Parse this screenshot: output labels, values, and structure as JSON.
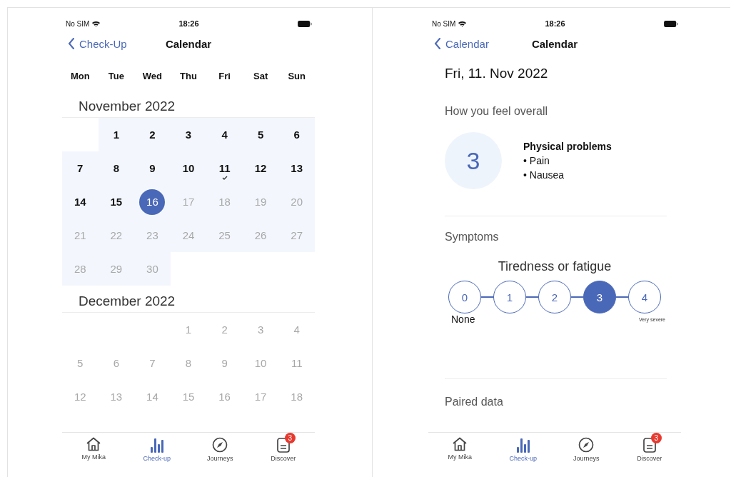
{
  "screens": [
    {
      "kind": "calendar",
      "status_bar": {
        "carrier": "No SIM",
        "time": "18:26"
      },
      "nav": {
        "back": "Check-Up",
        "title": "Calendar"
      },
      "weekdays": [
        "Mon",
        "Tue",
        "Wed",
        "Thu",
        "Fri",
        "Sat",
        "Sun"
      ],
      "months": [
        {
          "title": "November 2022",
          "weeks": [
            {
              "kind": "offset",
              "days": [
                {
                  "label": "1",
                  "past": true,
                  "in_month_range": true,
                  "selected": false,
                  "checked": false
                },
                {
                  "label": "2",
                  "past": true,
                  "in_month_range": true,
                  "selected": false,
                  "checked": false
                },
                {
                  "label": "3",
                  "past": true,
                  "in_month_range": true,
                  "selected": false,
                  "checked": false
                },
                {
                  "label": "4",
                  "past": true,
                  "in_month_range": true,
                  "selected": false,
                  "checked": false
                },
                {
                  "label": "5",
                  "past": true,
                  "in_month_range": true,
                  "selected": false,
                  "checked": false
                },
                {
                  "label": "6",
                  "past": true,
                  "in_month_range": true,
                  "selected": false,
                  "checked": false
                }
              ]
            },
            {
              "kind": "plain",
              "days": [
                {
                  "label": "7",
                  "past": true,
                  "in_month_range": true,
                  "selected": false,
                  "checked": false
                },
                {
                  "label": "8",
                  "past": true,
                  "in_month_range": true,
                  "selected": false,
                  "checked": false
                },
                {
                  "label": "9",
                  "past": true,
                  "in_month_range": true,
                  "selected": false,
                  "checked": false
                },
                {
                  "label": "10",
                  "past": true,
                  "in_month_range": true,
                  "selected": false,
                  "checked": false
                },
                {
                  "label": "11",
                  "past": true,
                  "in_month_range": true,
                  "selected": false,
                  "checked": true
                },
                {
                  "label": "12",
                  "past": true,
                  "in_month_range": true,
                  "selected": false,
                  "checked": false
                },
                {
                  "label": "13",
                  "past": true,
                  "in_month_range": true,
                  "selected": false,
                  "checked": false
                }
              ]
            },
            {
              "kind": "plain",
              "days": [
                {
                  "label": "14",
                  "past": true,
                  "in_month_range": true,
                  "selected": false,
                  "checked": false
                },
                {
                  "label": "15",
                  "past": true,
                  "in_month_range": true,
                  "selected": false,
                  "checked": false
                },
                {
                  "label": "16",
                  "past": true,
                  "in_month_range": true,
                  "selected": true,
                  "checked": false
                },
                {
                  "label": "17",
                  "past": false,
                  "in_month_range": true,
                  "selected": false,
                  "checked": false
                },
                {
                  "label": "18",
                  "past": false,
                  "in_month_range": true,
                  "selected": false,
                  "checked": false
                },
                {
                  "label": "19",
                  "past": false,
                  "in_month_range": true,
                  "selected": false,
                  "checked": false
                },
                {
                  "label": "20",
                  "past": false,
                  "in_month_range": true,
                  "selected": false,
                  "checked": false
                }
              ]
            },
            {
              "kind": "plain",
              "days": [
                {
                  "label": "21",
                  "past": false,
                  "in_month_range": true,
                  "selected": false,
                  "checked": false
                },
                {
                  "label": "22",
                  "past": false,
                  "in_month_range": true,
                  "selected": false,
                  "checked": false
                },
                {
                  "label": "23",
                  "past": false,
                  "in_month_range": true,
                  "selected": false,
                  "checked": false
                },
                {
                  "label": "24",
                  "past": false,
                  "in_month_range": true,
                  "selected": false,
                  "checked": false
                },
                {
                  "label": "25",
                  "past": false,
                  "in_month_range": true,
                  "selected": false,
                  "checked": false
                },
                {
                  "label": "26",
                  "past": false,
                  "in_month_range": true,
                  "selected": false,
                  "checked": false
                },
                {
                  "label": "27",
                  "past": false,
                  "in_month_range": true,
                  "selected": false,
                  "checked": false
                }
              ]
            },
            {
              "kind": "plain",
              "days": [
                {
                  "label": "28",
                  "past": false,
                  "in_month_range": true,
                  "selected": false,
                  "checked": false
                },
                {
                  "label": "29",
                  "past": false,
                  "in_month_range": true,
                  "selected": false,
                  "checked": false
                },
                {
                  "label": "30",
                  "past": false,
                  "in_month_range": true,
                  "selected": false,
                  "checked": false
                }
              ]
            }
          ]
        },
        {
          "title": "December 2022",
          "weeks": [
            {
              "kind": "offset",
              "days": [
                {
                  "label": "1",
                  "past": false,
                  "in_month_range": false,
                  "selected": false,
                  "checked": false
                },
                {
                  "label": "2",
                  "past": false,
                  "in_month_range": false,
                  "selected": false,
                  "checked": false
                },
                {
                  "label": "3",
                  "past": false,
                  "in_month_range": false,
                  "selected": false,
                  "checked": false
                },
                {
                  "label": "4",
                  "past": false,
                  "in_month_range": false,
                  "selected": false,
                  "checked": false
                }
              ]
            },
            {
              "kind": "plain",
              "days": [
                {
                  "label": "5",
                  "past": false,
                  "in_month_range": false,
                  "selected": false,
                  "checked": false
                },
                {
                  "label": "6",
                  "past": false,
                  "in_month_range": false,
                  "selected": false,
                  "checked": false
                },
                {
                  "label": "7",
                  "past": false,
                  "in_month_range": false,
                  "selected": false,
                  "checked": false
                },
                {
                  "label": "8",
                  "past": false,
                  "in_month_range": false,
                  "selected": false,
                  "checked": false
                },
                {
                  "label": "9",
                  "past": false,
                  "in_month_range": false,
                  "selected": false,
                  "checked": false
                },
                {
                  "label": "10",
                  "past": false,
                  "in_month_range": false,
                  "selected": false,
                  "checked": false
                },
                {
                  "label": "11",
                  "past": false,
                  "in_month_range": false,
                  "selected": false,
                  "checked": false
                }
              ]
            },
            {
              "kind": "plain",
              "days": [
                {
                  "label": "12",
                  "past": false,
                  "in_month_range": false,
                  "selected": false,
                  "checked": false
                },
                {
                  "label": "13",
                  "past": false,
                  "in_month_range": false,
                  "selected": false,
                  "checked": false
                },
                {
                  "label": "14",
                  "past": false,
                  "in_month_range": false,
                  "selected": false,
                  "checked": false
                },
                {
                  "label": "15",
                  "past": false,
                  "in_month_range": false,
                  "selected": false,
                  "checked": false
                },
                {
                  "label": "16",
                  "past": false,
                  "in_month_range": false,
                  "selected": false,
                  "checked": false
                },
                {
                  "label": "17",
                  "past": false,
                  "in_month_range": false,
                  "selected": false,
                  "checked": false
                },
                {
                  "label": "18",
                  "past": false,
                  "in_month_range": false,
                  "selected": false,
                  "checked": false
                }
              ]
            }
          ]
        }
      ],
      "tab_bar": [
        {
          "label": "My Mika",
          "selected": false
        },
        {
          "label": "Check-up",
          "selected": true
        },
        {
          "label": "Journeys",
          "selected": false
        },
        {
          "label": "Discover",
          "selected": false,
          "badge": "3"
        }
      ]
    },
    {
      "kind": "day",
      "status_bar": {
        "carrier": "No SIM",
        "time": "18:26"
      },
      "nav": {
        "back": "Calendar",
        "title": "Calendar"
      },
      "date": "Fri, 11. Nov 2022",
      "overall": {
        "heading": "How you feel overall",
        "score": "3",
        "problems_title": "Physical problems",
        "problems": [
          "• Pain",
          "• Nausea"
        ]
      },
      "symptoms": {
        "heading": "Symptoms",
        "name": "Tiredness or fatigue",
        "options": [
          {
            "label": "0",
            "selected": false
          },
          {
            "label": "1",
            "selected": false
          },
          {
            "label": "2",
            "selected": false
          },
          {
            "label": "3",
            "selected": true
          },
          {
            "label": "4",
            "selected": false
          }
        ],
        "low_label": "None",
        "high_label": "Very severe"
      },
      "paired": {
        "heading": "Paired data"
      },
      "tab_bar": [
        {
          "label": "My Mika",
          "selected": false
        },
        {
          "label": "Check-up",
          "selected": true
        },
        {
          "label": "Journeys",
          "selected": false
        },
        {
          "label": "Discover",
          "selected": false,
          "badge": "3"
        }
      ]
    }
  ]
}
